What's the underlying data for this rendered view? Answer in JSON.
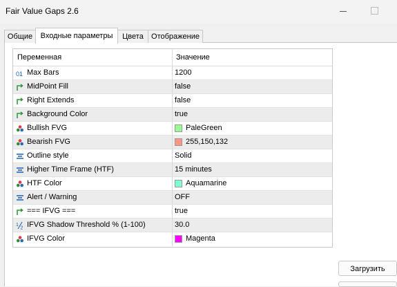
{
  "window": {
    "title": "Fair Value Gaps 2.6"
  },
  "tabs": [
    {
      "label": "Общие"
    },
    {
      "label": "Входные параметры"
    },
    {
      "label": "Цвета"
    },
    {
      "label": "Отображение"
    }
  ],
  "table": {
    "headers": {
      "variable": "Переменная",
      "value": "Значение"
    },
    "rows": [
      {
        "name": "Max Bars",
        "value": "1200",
        "icon": "integer-icon"
      },
      {
        "name": "MidPoint Fill",
        "value": "false",
        "icon": "bool-arrow-icon"
      },
      {
        "name": "Right Extends",
        "value": "false",
        "icon": "bool-arrow-icon"
      },
      {
        "name": "Background Color",
        "value": "true",
        "icon": "bool-arrow-icon"
      },
      {
        "name": "Bullish FVG",
        "value": "PaleGreen",
        "icon": "color-palette-icon",
        "swatch": "#98fb98"
      },
      {
        "name": "Bearish FVG",
        "value": "255,150,132",
        "icon": "color-palette-icon",
        "swatch": "#ff9684"
      },
      {
        "name": "Outline style",
        "value": "Solid",
        "icon": "enum-list-icon"
      },
      {
        "name": "Higher Time Frame (HTF)",
        "value": "15 minutes",
        "icon": "enum-list-icon"
      },
      {
        "name": "HTF Color",
        "value": "Aquamarine",
        "icon": "color-palette-icon",
        "swatch": "#7fffd4"
      },
      {
        "name": "Alert / Warning",
        "value": "OFF",
        "icon": "enum-list-icon"
      },
      {
        "name": "=== IFVG ===",
        "value": "true",
        "icon": "bool-arrow-icon"
      },
      {
        "name": "IFVG Shadow Threshold % (1-100)",
        "value": "30.0",
        "icon": "fraction-icon"
      },
      {
        "name": "IFVG Color",
        "value": "Magenta",
        "icon": "color-palette-icon",
        "swatch": "#ff00ff"
      }
    ]
  },
  "buttons": {
    "load": "Загрузить"
  }
}
